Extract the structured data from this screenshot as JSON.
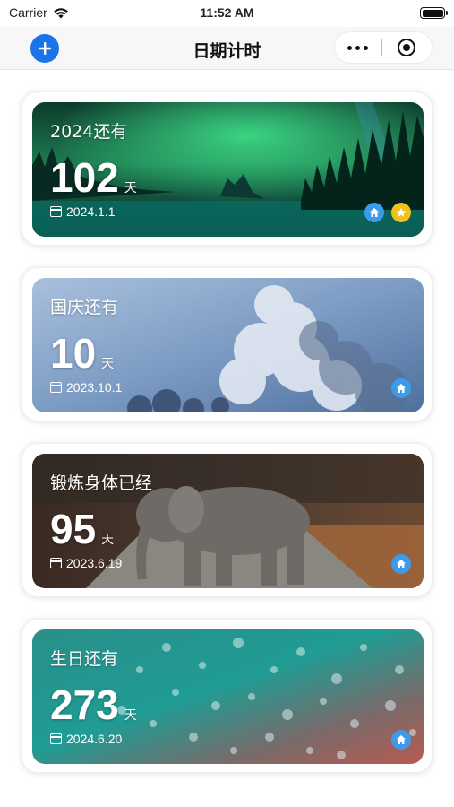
{
  "status_bar": {
    "carrier": "Carrier",
    "time": "11:52 AM"
  },
  "nav": {
    "title": "日期计时",
    "add_icon": "plus-icon",
    "more_icon": "more-dots-icon",
    "close_icon": "target-close-icon"
  },
  "cards": [
    {
      "title": "2024还有",
      "days": "102",
      "unit": "天",
      "date": "2024.1.1",
      "home_icon": "home-icon",
      "favorite": true,
      "background": "aurora"
    },
    {
      "title": "国庆还有",
      "days": "10",
      "unit": "天",
      "date": "2023.10.1",
      "home_icon": "home-icon",
      "favorite": false,
      "background": "clouds"
    },
    {
      "title": "锻炼身体已经",
      "days": "95",
      "unit": "天",
      "date": "2023.6.19",
      "home_icon": "home-icon",
      "favorite": false,
      "background": "elephant"
    },
    {
      "title": "生日还有",
      "days": "273",
      "unit": "天",
      "date": "2024.6.20",
      "home_icon": "home-icon",
      "favorite": false,
      "background": "droplets"
    }
  ],
  "colors": {
    "accent": "#1a73e8",
    "home_badge": "#3d9be9",
    "star_badge": "#f2c21b"
  }
}
